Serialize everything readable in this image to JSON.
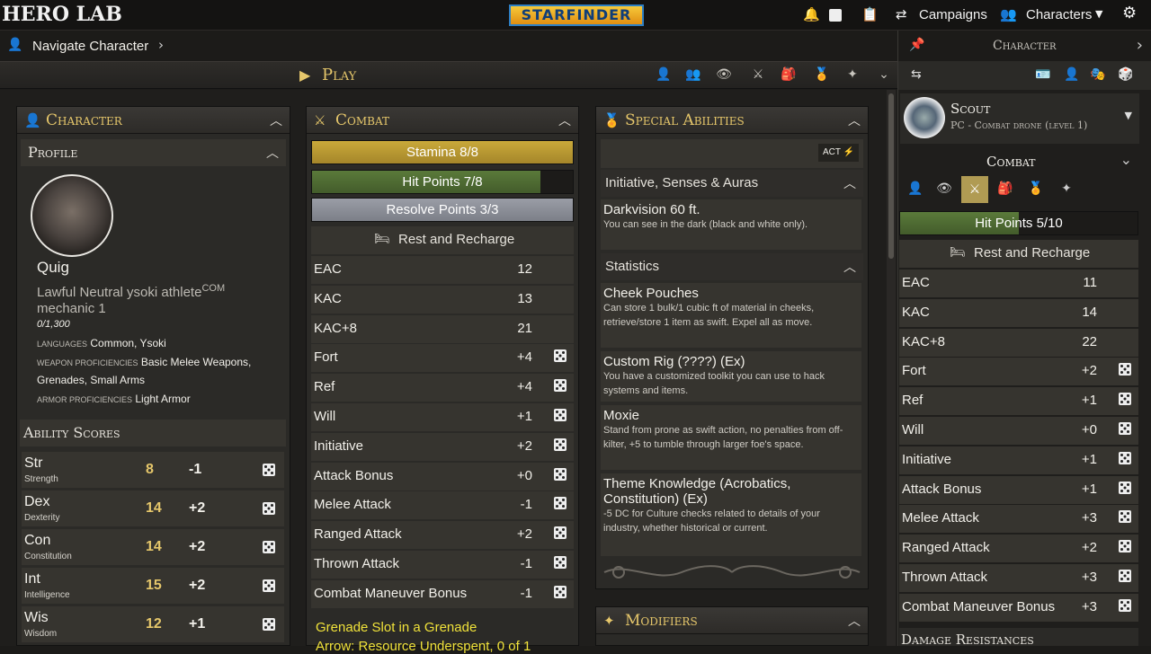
{
  "topbar": {
    "logo": "HERO LAB",
    "game_logo": "STARFINDER",
    "campaigns_label": "Campaigns",
    "characters_label": "Characters"
  },
  "nav": {
    "label": "Navigate Character"
  },
  "play": {
    "title": "Play"
  },
  "character_card": {
    "title": "Character",
    "profile_title": "Profile",
    "name": "Quig",
    "alignment_line": "Lawful Neutral ysoki athlete",
    "alignment_sup": "COM",
    "class_line": "mechanic 1",
    "xp": "0/1,300",
    "languages_label": "LANGUAGES",
    "languages_value": "Common, Ysoki",
    "weapon_label": "WEAPON PROFICIENCIES",
    "weapon_value_1": "Basic Melee Weapons,",
    "weapon_value_2": "Grenades, Small Arms",
    "armor_label": "ARMOR PROFICIENCIES",
    "armor_value": "Light Armor",
    "ability_scores_title": "Ability Scores",
    "abilities": [
      {
        "abbr": "Str",
        "full": "Strength",
        "score": "8",
        "mod": "-1"
      },
      {
        "abbr": "Dex",
        "full": "Dexterity",
        "score": "14",
        "mod": "+2"
      },
      {
        "abbr": "Con",
        "full": "Constitution",
        "score": "14",
        "mod": "+2"
      },
      {
        "abbr": "Int",
        "full": "Intelligence",
        "score": "15",
        "mod": "+2"
      },
      {
        "abbr": "Wis",
        "full": "Wisdom",
        "score": "12",
        "mod": "+1"
      }
    ]
  },
  "combat_card": {
    "title": "Combat",
    "stamina": "Stamina 8/8",
    "stamina_fraction": 1.0,
    "hit_points": "Hit Points 7/8",
    "hit_points_fraction": 0.875,
    "resolve": "Resolve Points 3/3",
    "rest": "Rest and Recharge",
    "stats": [
      {
        "label": "EAC",
        "value": "12",
        "die": false
      },
      {
        "label": "KAC",
        "value": "13",
        "die": false
      },
      {
        "label": "KAC+8",
        "value": "21",
        "die": false
      },
      {
        "label": "Fort",
        "value": "+4",
        "die": true
      },
      {
        "label": "Ref",
        "value": "+4",
        "die": true
      },
      {
        "label": "Will",
        "value": "+1",
        "die": true
      },
      {
        "label": "Initiative",
        "value": "+2",
        "die": true
      },
      {
        "label": "Attack Bonus",
        "value": "+0",
        "die": true
      },
      {
        "label": "Melee Attack",
        "value": "-1",
        "die": true
      },
      {
        "label": "Ranged Attack",
        "value": "+2",
        "die": true
      },
      {
        "label": "Thrown Attack",
        "value": "-1",
        "die": true
      },
      {
        "label": "Combat Maneuver Bonus",
        "value": "-1",
        "die": true
      }
    ],
    "grenade_line_1": "Grenade Slot in a Grenade",
    "grenade_line_2": "Arrow: Resource Underspent, 0 of 1"
  },
  "special_card": {
    "title": "Special Abilities",
    "act_label": "ACT",
    "senses_title": "Initiative, Senses & Auras",
    "statistics_title": "Statistics",
    "items": [
      {
        "name": "Darkvision 60 ft.",
        "desc": "You can see in the dark (black and white only)."
      },
      {
        "name": "Cheek Pouches",
        "desc": "Can store 1 bulk/1 cubic ft of material in cheeks, retrieve/store 1 item as swift. Expel all as move."
      },
      {
        "name": "Custom Rig (????) (Ex)",
        "desc": "You have a customized toolkit you can use to hack systems and items."
      },
      {
        "name": "Moxie",
        "desc": "Stand from prone as swift action, no penalties from off-kilter, +5 to tumble through larger foe's space."
      },
      {
        "name": "Theme Knowledge (Acrobatics, Constitution) (Ex)",
        "desc": "-5 DC for Culture checks related to details of your industry, whether historical or current."
      }
    ],
    "modifiers_title": "Modifiers"
  },
  "right_panel": {
    "header": "Character",
    "drone_name": "Scout",
    "drone_sub": "PC - Combat drone (level 1)",
    "combat_title": "Combat",
    "hit_points": "Hit Points 5/10",
    "hit_points_fraction": 0.5,
    "rest": "Rest and Recharge",
    "stats": [
      {
        "label": "EAC",
        "value": "11",
        "die": false
      },
      {
        "label": "KAC",
        "value": "14",
        "die": false
      },
      {
        "label": "KAC+8",
        "value": "22",
        "die": false
      },
      {
        "label": "Fort",
        "value": "+2",
        "die": true
      },
      {
        "label": "Ref",
        "value": "+1",
        "die": true
      },
      {
        "label": "Will",
        "value": "+0",
        "die": true
      },
      {
        "label": "Initiative",
        "value": "+1",
        "die": true
      },
      {
        "label": "Attack Bonus",
        "value": "+1",
        "die": true
      },
      {
        "label": "Melee Attack",
        "value": "+3",
        "die": true
      },
      {
        "label": "Ranged Attack",
        "value": "+2",
        "die": true
      },
      {
        "label": "Thrown Attack",
        "value": "+3",
        "die": true
      },
      {
        "label": "Combat Maneuver Bonus",
        "value": "+3",
        "die": true
      }
    ],
    "damage_res_title": "Damage Resistances"
  }
}
